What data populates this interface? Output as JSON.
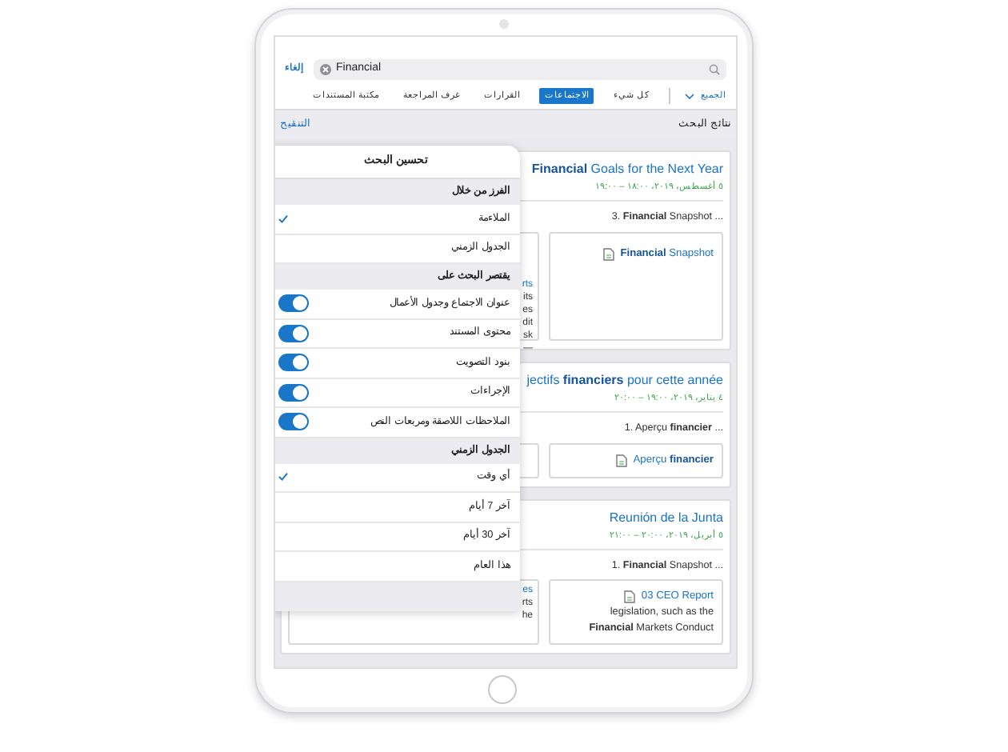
{
  "search": {
    "cancel": "إلغاء",
    "value": "Financial"
  },
  "filter_tabs": {
    "scope": "الجميع",
    "items": [
      {
        "label": "كل شيء",
        "selected": false
      },
      {
        "label": "الاجتماعات",
        "selected": true
      },
      {
        "label": "القرارات",
        "selected": false
      },
      {
        "label": "غرف المراجعة",
        "selected": false
      },
      {
        "label": "مكتبة المستندات",
        "selected": false
      }
    ]
  },
  "results_header": {
    "title": "نتائج البحث",
    "refine": "التنقيح"
  },
  "results": [
    {
      "title": "**Financial** Goals for the Next Year",
      "date": "٥ أغسطس، ٢٠١٩، ١٨:٠٠ – ١٩:٠٠",
      "snippet": "3. **Financial** Snapshot ...",
      "document": {
        "title": "**Financial** Snapshot"
      },
      "partial_document": [
        {
          "text": "rts",
          "link": true
        },
        {
          "text": "its",
          "link": false
        },
        {
          "text": "es",
          "link": false
        },
        {
          "text": "dit",
          "link": false
        },
        {
          "text": "sk",
          "link": false
        },
        {
          "text": "—",
          "link": false
        }
      ]
    },
    {
      "title": "jectifs **financiers** pour cette année",
      "date": "٤ يناير، ٢٠١٩، ١٩:٠٠ – ٢٠:٠٠",
      "snippet": "1. Aperçu **financier** ...",
      "document": {
        "title": "Aperçu **financier**"
      }
    },
    {
      "title": "Reunión de la Junta",
      "date": "٥ أبريل، ٢٠١٩، ٢٠:٠٠ – ٢١:٠٠",
      "snippet": "1. **Financial** Snapshot ...",
      "document": {
        "title": "03 CEO Report",
        "lines": [
          "legislation, such as the",
          "**Financial** Markets Conduct"
        ]
      },
      "partial_document": [
        {
          "text": "es",
          "link": true
        },
        {
          "text": "rts",
          "link": false
        },
        {
          "text": "he",
          "link": false
        }
      ]
    }
  ],
  "refine_panel": {
    "title": "تحسين البحث",
    "sections": [
      {
        "header": "الفرز من خلال",
        "rows": [
          {
            "kind": "check",
            "label": "الملاءمة",
            "checked": true
          },
          {
            "kind": "check",
            "label": "الجدول الزمني",
            "checked": false
          }
        ]
      },
      {
        "header": "يقتصر البحث على",
        "rows": [
          {
            "kind": "toggle",
            "label": "عنوان الاجتماع وجدول الأعمال",
            "on": true
          },
          {
            "kind": "toggle",
            "label": "محتوى المستند",
            "on": true
          },
          {
            "kind": "toggle",
            "label": "بنود التصويت",
            "on": true
          },
          {
            "kind": "toggle",
            "label": "الإجراءات",
            "on": true
          },
          {
            "kind": "toggle",
            "label": "الملاحظات اللاصقة ومربعات النص",
            "on": true
          }
        ]
      },
      {
        "header": "الجدول الزمني",
        "rows": [
          {
            "kind": "check",
            "label": "أي وقت",
            "checked": true
          },
          {
            "kind": "check",
            "label": "آخر 7 أيام",
            "checked": false
          },
          {
            "kind": "check",
            "label": "آخر 30 أيام",
            "checked": false
          },
          {
            "kind": "check",
            "label": "هذا العام",
            "checked": false
          }
        ]
      }
    ]
  }
}
